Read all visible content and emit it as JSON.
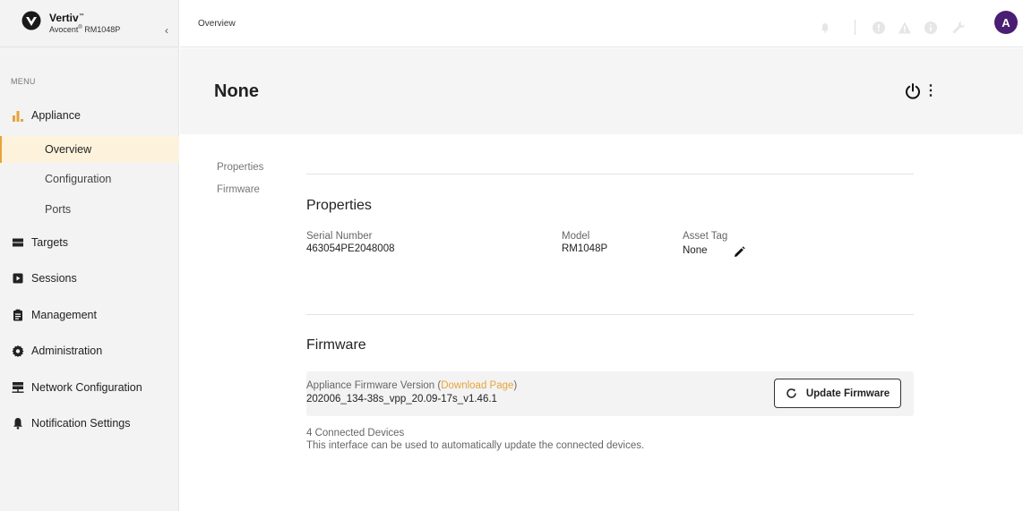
{
  "brand": {
    "name": "Vertiv",
    "trademark": "™",
    "product_prefix": "Avocent",
    "product_reg": "®",
    "product_model": " RM1048P",
    "collapse_glyph": "‹"
  },
  "sidebar": {
    "menu_label": "MENU",
    "appliance": {
      "label": "Appliance",
      "icon": "bar-chart-icon",
      "color": "#e8a33a"
    },
    "sub_items": [
      {
        "label": "Overview",
        "active": true
      },
      {
        "label": "Configuration",
        "active": false
      },
      {
        "label": "Ports",
        "active": false
      }
    ],
    "items": [
      {
        "label": "Targets",
        "icon": "server-icon"
      },
      {
        "label": "Sessions",
        "icon": "play-icon"
      },
      {
        "label": "Management",
        "icon": "clipboard-icon"
      },
      {
        "label": "Administration",
        "icon": "gear-icon"
      },
      {
        "label": "Network Configuration",
        "icon": "network-icon"
      },
      {
        "label": "Notification Settings",
        "icon": "bell-icon"
      }
    ]
  },
  "topbar": {
    "breadcrumb": "Overview",
    "icons": [
      "bell-icon",
      "alert-circle-icon",
      "warning-triangle-icon",
      "info-circle-icon",
      "wrench-icon"
    ],
    "avatar_letter": "A",
    "avatar_color": "#4a1e73"
  },
  "header": {
    "title": "None"
  },
  "anchors": {
    "properties": "Properties",
    "firmware": "Firmware"
  },
  "properties": {
    "title": "Properties",
    "serial_label": "Serial Number",
    "serial_value": "463054PE2048008",
    "model_label": "Model",
    "model_value": "RM1048P",
    "asset_label": "Asset Tag",
    "asset_value": "None"
  },
  "firmware": {
    "title": "Firmware",
    "version_label": "Appliance Firmware Version (",
    "download_link": "Download Page",
    "version_label_end": ")",
    "version_value": "202006_134-38s_vpp_20.09-17s_v1.46.1",
    "update_button": "Update Firmware",
    "devices_count": "4 Connected Devices",
    "devices_desc": "This interface can be used to automatically update the connected devices.",
    "accent_color": "#e8a33a"
  }
}
